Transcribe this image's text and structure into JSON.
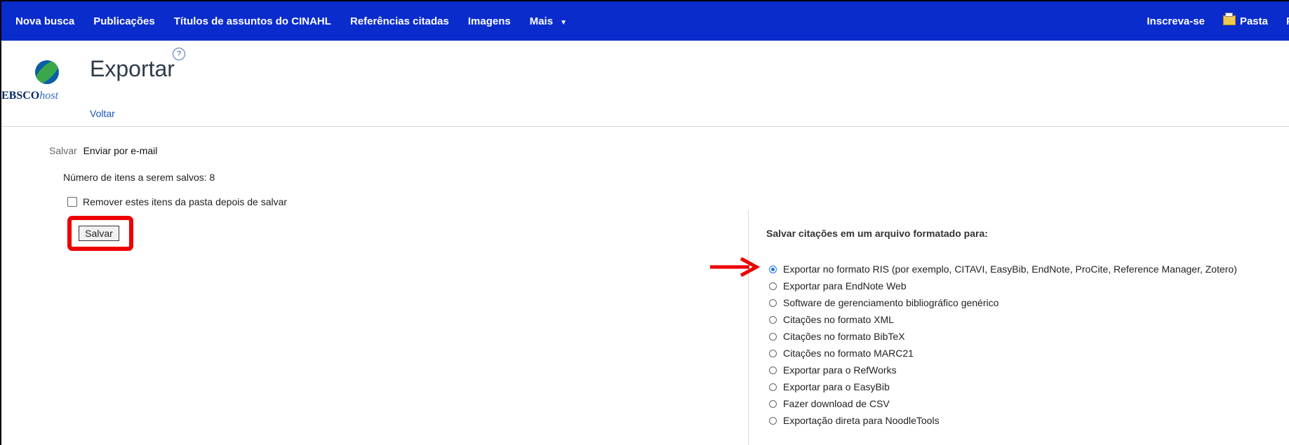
{
  "nav": {
    "left": [
      {
        "label": "Nova busca"
      },
      {
        "label": "Publicações"
      },
      {
        "label": "Títulos de assuntos do CINAHL"
      },
      {
        "label": "Referências citadas"
      },
      {
        "label": "Imagens"
      },
      {
        "label": "Mais"
      }
    ],
    "right": [
      {
        "label": "Inscreva-se"
      },
      {
        "label": "Pasta"
      },
      {
        "label": "P"
      }
    ]
  },
  "brand": {
    "logo_main": "EBSCO",
    "logo_sub": "host"
  },
  "header": {
    "title": "Exportar",
    "help": "?",
    "back": "Voltar"
  },
  "save_panel": {
    "save_label": "Salvar",
    "email_label": "Enviar por e-mail",
    "count_text": "Número de itens a serem salvos: 8",
    "remove_label": "Remover estes itens da pasta depois de salvar",
    "save_button": "Salvar"
  },
  "format_panel": {
    "heading": "Salvar citações em um arquivo formatado para:",
    "selected_index": 0,
    "options": [
      {
        "label": "Exportar no formato RIS (por exemplo, CITAVI, EasyBib, EndNote, ProCite, Reference Manager, Zotero)"
      },
      {
        "label": "Exportar para EndNote Web"
      },
      {
        "label": "Software de gerenciamento bibliográfico genérico"
      },
      {
        "label": "Citações no formato XML"
      },
      {
        "label": "Citações no formato BibTeX"
      },
      {
        "label": "Citações no formato MARC21"
      },
      {
        "label": "Exportar para o RefWorks"
      },
      {
        "label": "Exportar para o EasyBib"
      },
      {
        "label": "Fazer download de CSV"
      },
      {
        "label": "Exportação direta para NoodleTools"
      }
    ]
  },
  "colors": {
    "nav_bg": "#0a2ccc",
    "highlight": "#ee0000",
    "link": "#1a56b8"
  }
}
